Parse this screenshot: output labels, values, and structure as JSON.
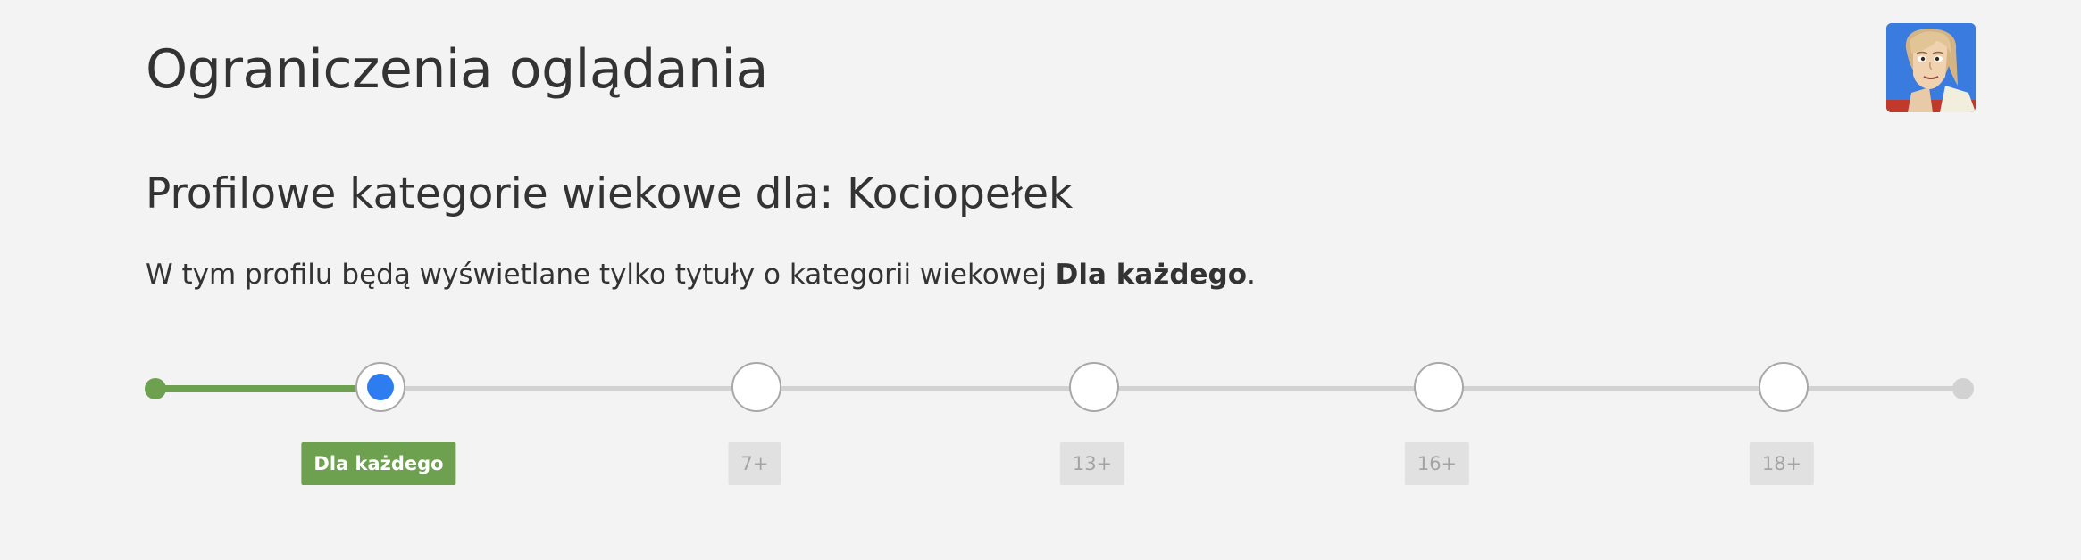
{
  "header": {
    "title": "Ograniczenia oglądania"
  },
  "profile": {
    "name": "Kociopełek",
    "avatar_icon": "cartoon-character-avatar"
  },
  "section": {
    "title": "Profilowe kategorie wiekowe dla: Kociopełek"
  },
  "description": {
    "prefix": "W tym profilu będą wyświetlane tylko tytuły o kategorii wiekowej ",
    "selected_rating": "Dla każdego",
    "suffix": "."
  },
  "slider": {
    "selected_index": 0,
    "labels": [
      "Dla każdego",
      "7+",
      "13+",
      "16+",
      "18+"
    ]
  },
  "colors": {
    "accent_green": "#6ea14f",
    "selected_blue": "#2d7df0",
    "track_gray": "#d2d2d2",
    "background": "#f3f3f3"
  }
}
